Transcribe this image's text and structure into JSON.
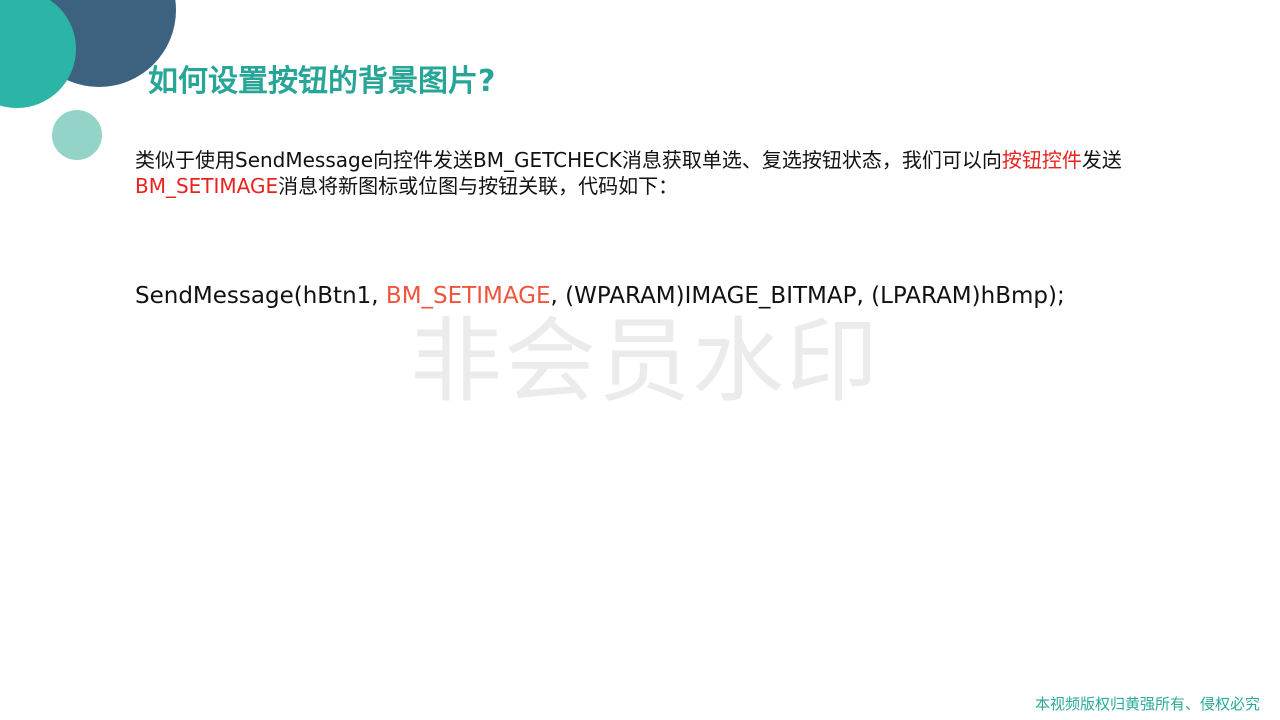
{
  "slide": {
    "title": "如何设置按钮的背景图片?",
    "paragraph": {
      "part1": "类似于使用SendMessage向控件发送BM_GETCHECK消息获取单选、复选按钮状态，我们可以向",
      "highlight1": "按钮控件",
      "part2": "发送",
      "highlight2": "BM_SETIMAGE",
      "part3": "消息将新图标或位图与按钮关联，代码如下："
    },
    "code": {
      "prefix": "SendMessage(hBtn1, ",
      "highlight": "BM_SETIMAGE",
      "suffix": ", (WPARAM)IMAGE_BITMAP, (LPARAM)hBmp);"
    },
    "watermark": "非会员水印",
    "copyright": "本视频版权归黄强所有、侵权必究"
  },
  "colors": {
    "title": "#27a597",
    "highlight": "#e8231f",
    "code_highlight": "#f0543c",
    "deco_dark": "#3d6280",
    "deco_teal": "#2bb5a6",
    "deco_light": "#93d3c8",
    "copyright": "#2aa99b"
  }
}
